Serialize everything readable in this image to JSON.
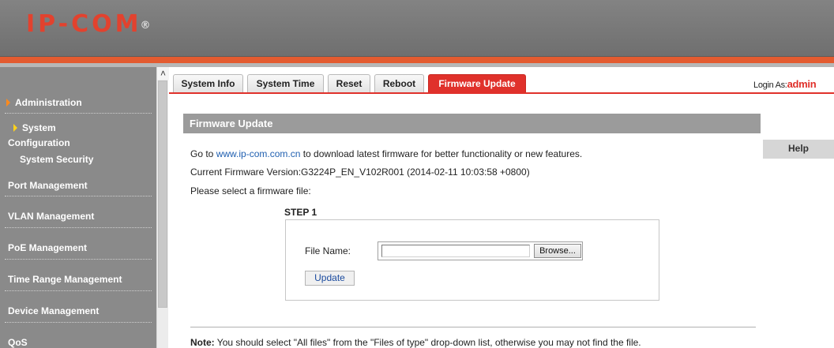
{
  "brand": {
    "logo_text": "IP-COM",
    "registered_mark": "®",
    "accent": "#e0312b"
  },
  "sidebar": {
    "items": [
      {
        "label": "Administration"
      },
      {
        "label": "System"
      },
      {
        "label": "Configuration"
      },
      {
        "label": "System Security"
      },
      {
        "label": "Port Management"
      },
      {
        "label": "VLAN Management"
      },
      {
        "label": "PoE Management"
      },
      {
        "label": "Time Range Management"
      },
      {
        "label": "Device Management"
      },
      {
        "label": "QoS"
      }
    ]
  },
  "tabs": [
    {
      "label": "System Info"
    },
    {
      "label": "System Time"
    },
    {
      "label": "Reset"
    },
    {
      "label": "Reboot"
    },
    {
      "label": "Firmware Update",
      "active": true
    }
  ],
  "login": {
    "prefix": "Login As:",
    "user": "admin"
  },
  "help_label": "Help",
  "main": {
    "section_title": "Firmware Update",
    "line1_prefix": "Go to ",
    "line1_link": "www.ip-com.com.cn",
    "line1_suffix": " to download latest firmware for better functionality or new features.",
    "firmware_version": "Current Firmware Version:G3224P_EN_V102R001 (2014-02-11 10:03:58 +0800)",
    "select_prompt": "Please select a firmware file:",
    "step_label": "STEP 1",
    "file_name_label": "File Name:",
    "file_value": "",
    "browse_label": "Browse...",
    "update_label": "Update",
    "note_label": "Note:",
    "note_text": " You should select \"All files\" from the \"Files of type\" drop-down list, otherwise you may not find the file."
  },
  "icons": {
    "scroll_up": "chevron-up-icon",
    "nav_arrow": "triangle-right-icon"
  }
}
